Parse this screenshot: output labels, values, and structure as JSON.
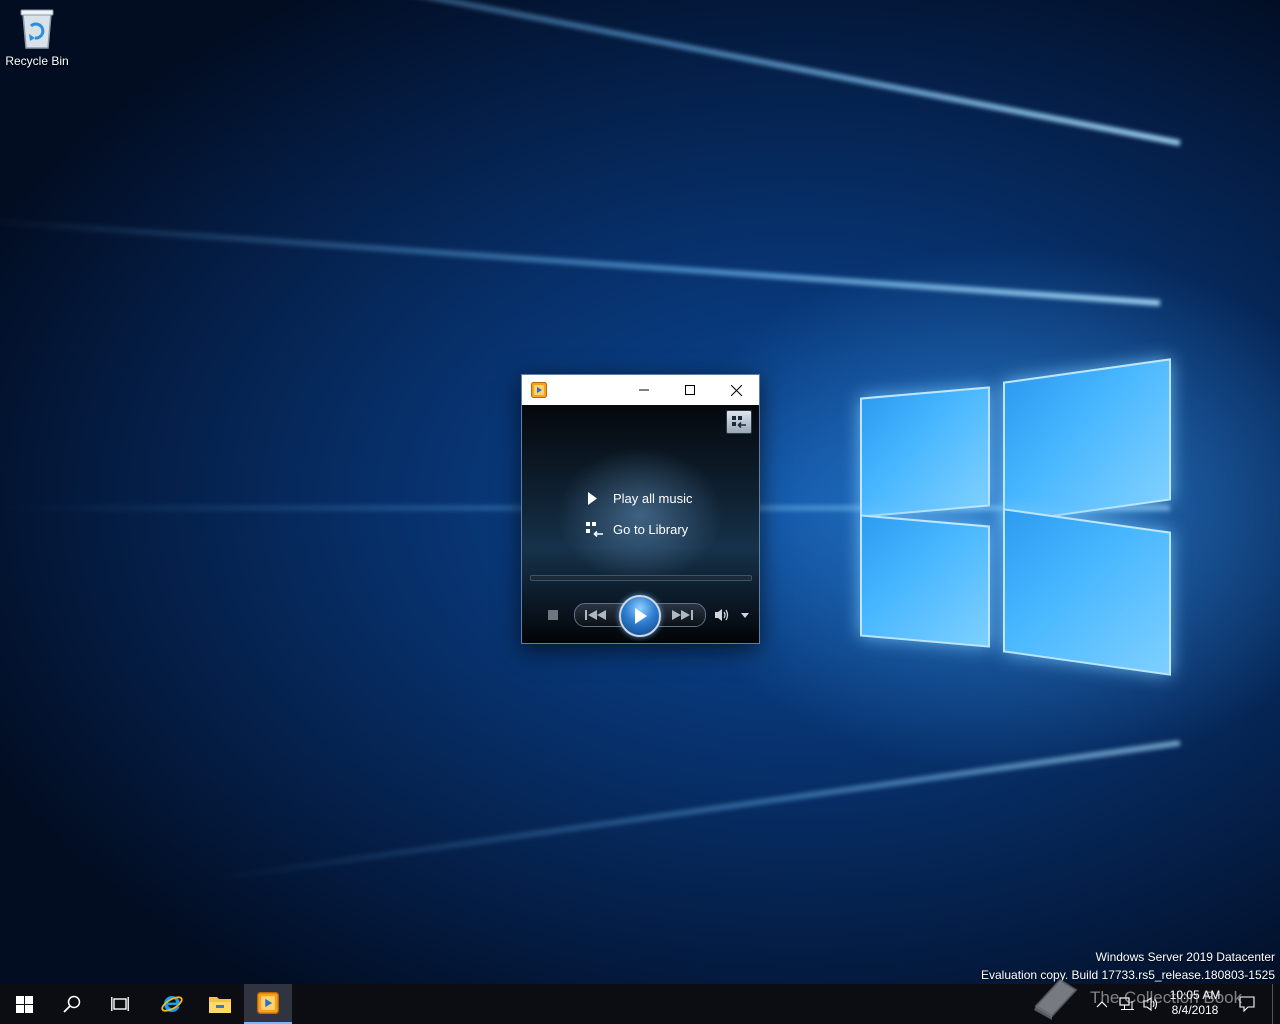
{
  "desktop": {
    "icons": [
      {
        "label": "Recycle Bin",
        "icon": "recycle-bin-icon"
      }
    ]
  },
  "player": {
    "app_icon": "media-player-icon",
    "title": "",
    "window_buttons": {
      "minimize": "minimize-icon",
      "maximize": "maximize-icon",
      "close": "close-icon"
    },
    "switch_view_icon": "switch-to-library-icon",
    "links": [
      {
        "label": "Play all music",
        "icon": "play-icon"
      },
      {
        "label": "Go to Library",
        "icon": "library-icon"
      }
    ],
    "controls": [
      "stop-icon",
      "previous-icon",
      "play-icon",
      "next-icon",
      "volume-icon",
      "dropdown-arrow-icon"
    ],
    "progress": 0
  },
  "watermark": {
    "line1": "Windows Server 2019 Datacenter",
    "line2": "Evaluation copy. Build 17733.rs5_release.180803-1525"
  },
  "taskbar": {
    "buttons": [
      "start-icon",
      "search-icon",
      "task-view-icon",
      "internet-explorer-icon",
      "file-explorer-icon",
      "media-player-icon"
    ],
    "active": "media-player-icon",
    "tray_icons": [
      "show-hidden-icons-chevron",
      "network-icon",
      "volume-icon",
      "action-center-icon"
    ],
    "clock": {
      "time": "10:05 AM",
      "date": "8/4/2018"
    }
  },
  "overlay_watermark": {
    "text": "The Collection Book"
  },
  "colors": {
    "accent": "#78b8ff",
    "taskbar": "#0b0d12",
    "desktop": "#07306a"
  }
}
